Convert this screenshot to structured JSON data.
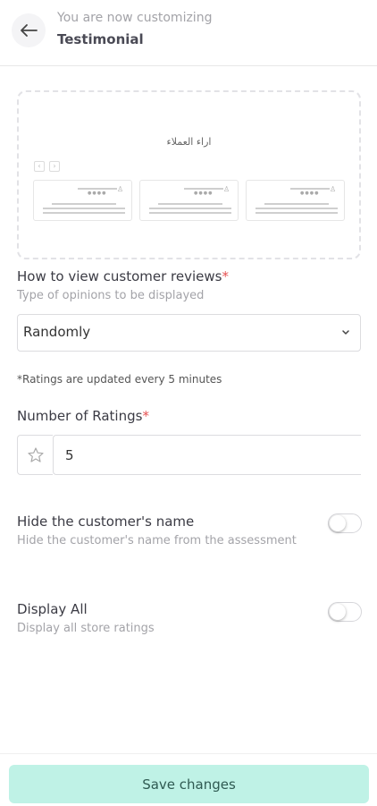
{
  "header": {
    "subtitle": "You are now customizing",
    "title": "Testimonial",
    "back_icon": "arrow-left-icon"
  },
  "preview": {
    "title": "اراء العملاء",
    "prev_icon": "chevron-left-icon",
    "next_icon": "chevron-right-icon",
    "card_icon": "user-icon",
    "card_stars": "●●●●"
  },
  "review_view": {
    "label": "How to view customer reviews",
    "required_mark": "*",
    "help": "Type of opinions to be displayed",
    "selected": "Randomly",
    "chevron_icon": "chevron-down-icon"
  },
  "note": "*Ratings are updated every 5 minutes",
  "ratings": {
    "label": "Number of Ratings",
    "required_mark": "*",
    "value": "5",
    "star_icon": "star-outline-icon"
  },
  "hide_name": {
    "label": "Hide the customer's name",
    "help": "Hide the customer's name from the assessment",
    "on": false
  },
  "display_all": {
    "label": "Display All",
    "help": "Display all store ratings",
    "on": false
  },
  "footer": {
    "save_label": "Save changes",
    "accent": "#bff2e6"
  }
}
